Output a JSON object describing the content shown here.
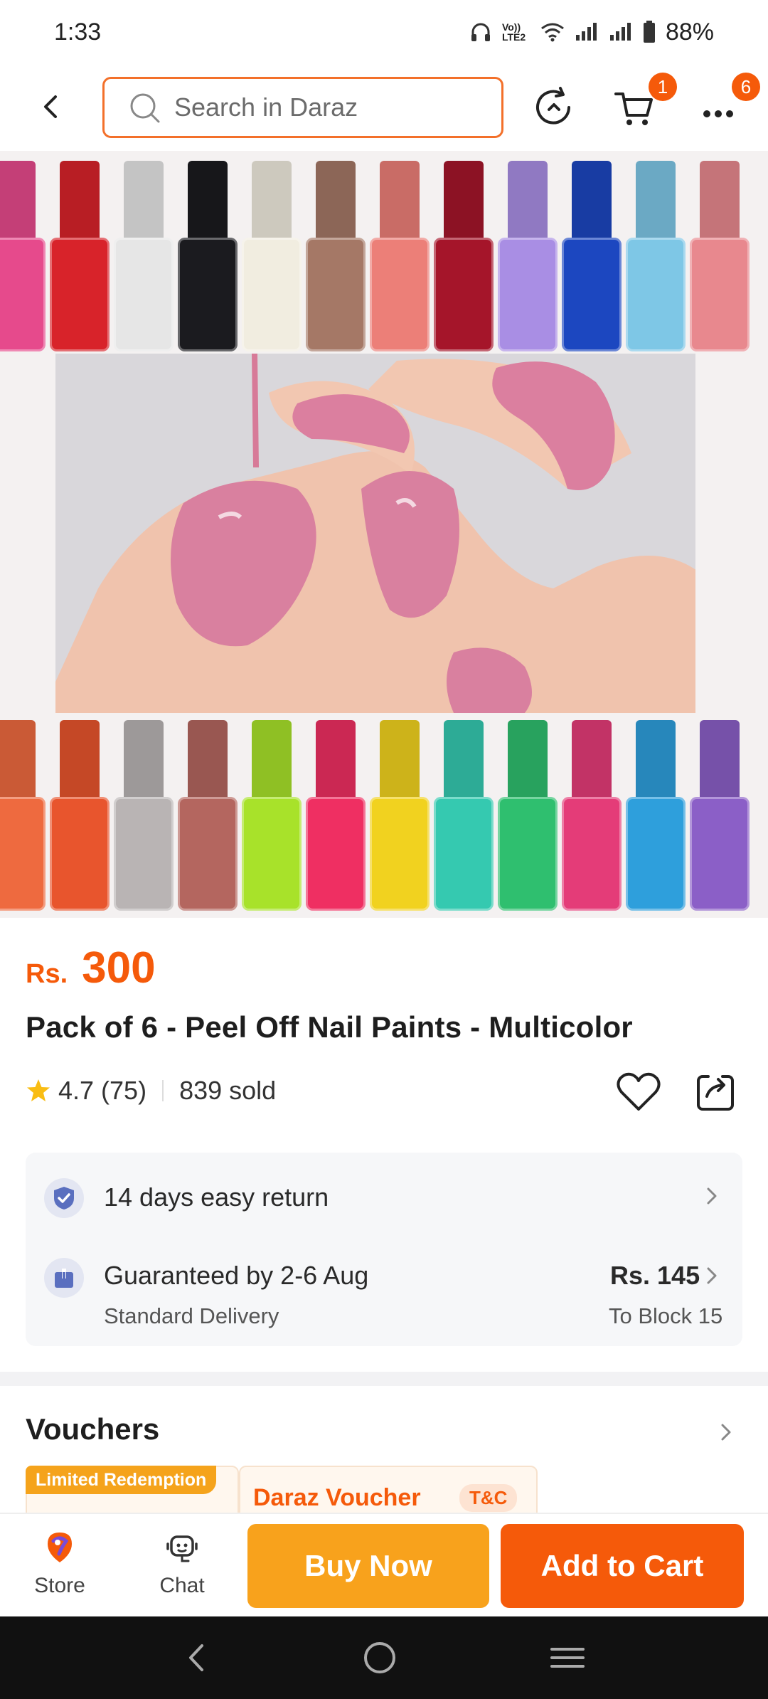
{
  "status_bar": {
    "time": "1:33",
    "network_label": "Vo)) LTE2",
    "battery": "88%"
  },
  "header": {
    "search_placeholder": "Search in Daraz",
    "cart_badge": "1",
    "more_badge": "6"
  },
  "product": {
    "currency": "Rs.",
    "price": "300",
    "title": "Pack of 6 - Peel Off Nail Paints - Multicolor",
    "rating": "4.7",
    "rating_count": "(75)",
    "sold": "839 sold"
  },
  "services": {
    "return_text": "14 days easy return",
    "delivery_text": "Guaranteed by 2-6 Aug",
    "delivery_sub": "Standard Delivery",
    "delivery_price": "Rs. 145",
    "delivery_location": "To Block 15"
  },
  "vouchers": {
    "title": "Vouchers",
    "limited_badge": "Limited Redemption",
    "voucher_name": "Daraz Voucher",
    "tnc": "T&C"
  },
  "action_bar": {
    "store_label": "Store",
    "chat_label": "Chat",
    "buy_now": "Buy Now",
    "add_to_cart": "Add to Cart"
  },
  "colors": {
    "accent": "#f55a0a",
    "buy_now": "#f8a21c",
    "top_bottles": [
      "#e64a8c",
      "#d8232a",
      "#e6e6e6",
      "#1b1b1f",
      "#f1ede0",
      "#a57866",
      "#ec7f78",
      "#a5152a",
      "#a98ee4",
      "#1c47c0",
      "#7ec7e6",
      "#e8888e"
    ],
    "bottom_bottles": [
      "#ee6a3f",
      "#e8552d",
      "#b9b4b4",
      "#b4665f",
      "#a8e22a",
      "#ef2f62",
      "#f1d21f",
      "#35c9b0",
      "#2fbf6f",
      "#e43c78",
      "#2e9fdc",
      "#8b5fc7"
    ]
  }
}
